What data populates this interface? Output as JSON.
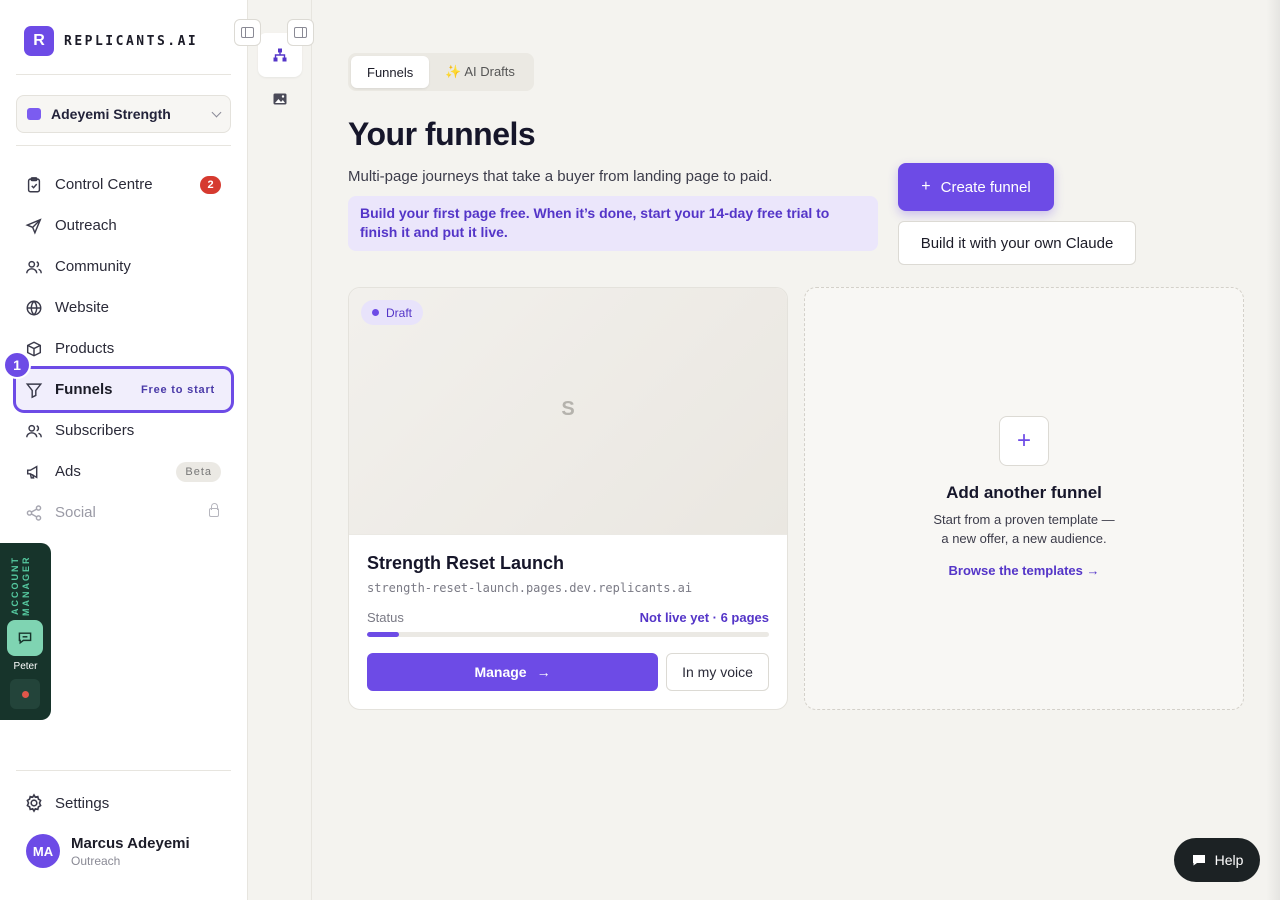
{
  "brand": {
    "mark": "R",
    "name": "REPLICANTS.AI"
  },
  "workspace": {
    "name": "Adeyemi Strength"
  },
  "nav": {
    "items": [
      {
        "label": "Control Centre",
        "icon": "clipboard-icon",
        "count": "2"
      },
      {
        "label": "Outreach",
        "icon": "send-icon"
      },
      {
        "label": "Community",
        "icon": "people-icon"
      },
      {
        "label": "Website",
        "icon": "globe-icon"
      },
      {
        "label": "Products",
        "icon": "box-icon"
      },
      {
        "label": "Funnels",
        "icon": "funnel-icon",
        "tag": "Free to start"
      },
      {
        "label": "Subscribers",
        "icon": "users-icon"
      },
      {
        "label": "Ads",
        "icon": "megaphone-icon",
        "tag": "Beta"
      },
      {
        "label": "Social",
        "icon": "share-icon"
      }
    ],
    "step_badge": "1"
  },
  "account_manager": {
    "label": "ACCOUNT MANAGER",
    "name": "Peter",
    "status_color": "#e0564a"
  },
  "settings": {
    "label": "Settings"
  },
  "user": {
    "initials": "MA",
    "name": "Marcus Adeyemi",
    "role": "Outreach"
  },
  "tabs": [
    {
      "label": "Funnels",
      "active": true
    },
    {
      "label": "✨ AI Drafts",
      "active": false
    }
  ],
  "main": {
    "title": "Your funnels",
    "subtitle": "Multi-page journeys that take a buyer from landing page to paid.",
    "notice": "Build your first page free. When it’s done, start your 14-day free trial to finish it and put it live.",
    "create_button": "Create funnel",
    "claude_button": "Build it with your own Claude"
  },
  "funnel_card": {
    "badge": "Draft",
    "preview_letter": "S",
    "title": "Strength Reset Launch",
    "url": "strength-reset-launch.pages.dev.replicants.ai",
    "status_label": "Status",
    "status_value": "Not live yet · 6 pages",
    "progress": 0.08,
    "manage_button": "Manage",
    "voice_button": "In my voice"
  },
  "add_card": {
    "title": "Add another funnel",
    "desc_line1": "Start from a proven template —",
    "desc_line2": "a new offer, a new audience.",
    "link": "Browse the templates"
  },
  "help": {
    "label": "Help"
  },
  "colors": {
    "accent": "#6d4be6",
    "accent_dark": "#5435c8",
    "count_badge": "#d63a2f",
    "am_panel": "#17342b"
  }
}
